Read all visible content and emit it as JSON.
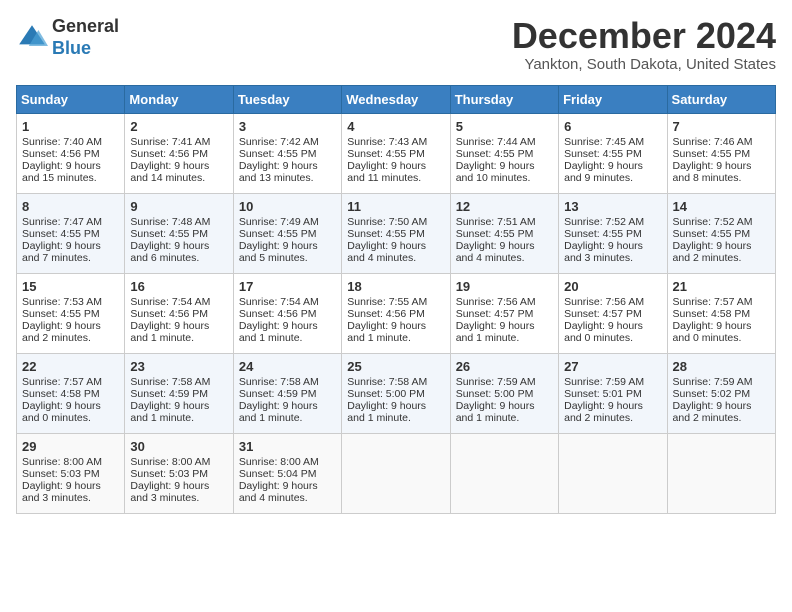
{
  "logo": {
    "general": "General",
    "blue": "Blue"
  },
  "title": "December 2024",
  "location": "Yankton, South Dakota, United States",
  "days_header": [
    "Sunday",
    "Monday",
    "Tuesday",
    "Wednesday",
    "Thursday",
    "Friday",
    "Saturday"
  ],
  "weeks": [
    [
      {
        "day": "1",
        "sunrise": "Sunrise: 7:40 AM",
        "sunset": "Sunset: 4:56 PM",
        "daylight": "Daylight: 9 hours and 15 minutes."
      },
      {
        "day": "2",
        "sunrise": "Sunrise: 7:41 AM",
        "sunset": "Sunset: 4:56 PM",
        "daylight": "Daylight: 9 hours and 14 minutes."
      },
      {
        "day": "3",
        "sunrise": "Sunrise: 7:42 AM",
        "sunset": "Sunset: 4:55 PM",
        "daylight": "Daylight: 9 hours and 13 minutes."
      },
      {
        "day": "4",
        "sunrise": "Sunrise: 7:43 AM",
        "sunset": "Sunset: 4:55 PM",
        "daylight": "Daylight: 9 hours and 11 minutes."
      },
      {
        "day": "5",
        "sunrise": "Sunrise: 7:44 AM",
        "sunset": "Sunset: 4:55 PM",
        "daylight": "Daylight: 9 hours and 10 minutes."
      },
      {
        "day": "6",
        "sunrise": "Sunrise: 7:45 AM",
        "sunset": "Sunset: 4:55 PM",
        "daylight": "Daylight: 9 hours and 9 minutes."
      },
      {
        "day": "7",
        "sunrise": "Sunrise: 7:46 AM",
        "sunset": "Sunset: 4:55 PM",
        "daylight": "Daylight: 9 hours and 8 minutes."
      }
    ],
    [
      {
        "day": "8",
        "sunrise": "Sunrise: 7:47 AM",
        "sunset": "Sunset: 4:55 PM",
        "daylight": "Daylight: 9 hours and 7 minutes."
      },
      {
        "day": "9",
        "sunrise": "Sunrise: 7:48 AM",
        "sunset": "Sunset: 4:55 PM",
        "daylight": "Daylight: 9 hours and 6 minutes."
      },
      {
        "day": "10",
        "sunrise": "Sunrise: 7:49 AM",
        "sunset": "Sunset: 4:55 PM",
        "daylight": "Daylight: 9 hours and 5 minutes."
      },
      {
        "day": "11",
        "sunrise": "Sunrise: 7:50 AM",
        "sunset": "Sunset: 4:55 PM",
        "daylight": "Daylight: 9 hours and 4 minutes."
      },
      {
        "day": "12",
        "sunrise": "Sunrise: 7:51 AM",
        "sunset": "Sunset: 4:55 PM",
        "daylight": "Daylight: 9 hours and 4 minutes."
      },
      {
        "day": "13",
        "sunrise": "Sunrise: 7:52 AM",
        "sunset": "Sunset: 4:55 PM",
        "daylight": "Daylight: 9 hours and 3 minutes."
      },
      {
        "day": "14",
        "sunrise": "Sunrise: 7:52 AM",
        "sunset": "Sunset: 4:55 PM",
        "daylight": "Daylight: 9 hours and 2 minutes."
      }
    ],
    [
      {
        "day": "15",
        "sunrise": "Sunrise: 7:53 AM",
        "sunset": "Sunset: 4:55 PM",
        "daylight": "Daylight: 9 hours and 2 minutes."
      },
      {
        "day": "16",
        "sunrise": "Sunrise: 7:54 AM",
        "sunset": "Sunset: 4:56 PM",
        "daylight": "Daylight: 9 hours and 1 minute."
      },
      {
        "day": "17",
        "sunrise": "Sunrise: 7:54 AM",
        "sunset": "Sunset: 4:56 PM",
        "daylight": "Daylight: 9 hours and 1 minute."
      },
      {
        "day": "18",
        "sunrise": "Sunrise: 7:55 AM",
        "sunset": "Sunset: 4:56 PM",
        "daylight": "Daylight: 9 hours and 1 minute."
      },
      {
        "day": "19",
        "sunrise": "Sunrise: 7:56 AM",
        "sunset": "Sunset: 4:57 PM",
        "daylight": "Daylight: 9 hours and 1 minute."
      },
      {
        "day": "20",
        "sunrise": "Sunrise: 7:56 AM",
        "sunset": "Sunset: 4:57 PM",
        "daylight": "Daylight: 9 hours and 0 minutes."
      },
      {
        "day": "21",
        "sunrise": "Sunrise: 7:57 AM",
        "sunset": "Sunset: 4:58 PM",
        "daylight": "Daylight: 9 hours and 0 minutes."
      }
    ],
    [
      {
        "day": "22",
        "sunrise": "Sunrise: 7:57 AM",
        "sunset": "Sunset: 4:58 PM",
        "daylight": "Daylight: 9 hours and 0 minutes."
      },
      {
        "day": "23",
        "sunrise": "Sunrise: 7:58 AM",
        "sunset": "Sunset: 4:59 PM",
        "daylight": "Daylight: 9 hours and 1 minute."
      },
      {
        "day": "24",
        "sunrise": "Sunrise: 7:58 AM",
        "sunset": "Sunset: 4:59 PM",
        "daylight": "Daylight: 9 hours and 1 minute."
      },
      {
        "day": "25",
        "sunrise": "Sunrise: 7:58 AM",
        "sunset": "Sunset: 5:00 PM",
        "daylight": "Daylight: 9 hours and 1 minute."
      },
      {
        "day": "26",
        "sunrise": "Sunrise: 7:59 AM",
        "sunset": "Sunset: 5:00 PM",
        "daylight": "Daylight: 9 hours and 1 minute."
      },
      {
        "day": "27",
        "sunrise": "Sunrise: 7:59 AM",
        "sunset": "Sunset: 5:01 PM",
        "daylight": "Daylight: 9 hours and 2 minutes."
      },
      {
        "day": "28",
        "sunrise": "Sunrise: 7:59 AM",
        "sunset": "Sunset: 5:02 PM",
        "daylight": "Daylight: 9 hours and 2 minutes."
      }
    ],
    [
      {
        "day": "29",
        "sunrise": "Sunrise: 8:00 AM",
        "sunset": "Sunset: 5:03 PM",
        "daylight": "Daylight: 9 hours and 3 minutes."
      },
      {
        "day": "30",
        "sunrise": "Sunrise: 8:00 AM",
        "sunset": "Sunset: 5:03 PM",
        "daylight": "Daylight: 9 hours and 3 minutes."
      },
      {
        "day": "31",
        "sunrise": "Sunrise: 8:00 AM",
        "sunset": "Sunset: 5:04 PM",
        "daylight": "Daylight: 9 hours and 4 minutes."
      },
      null,
      null,
      null,
      null
    ]
  ]
}
